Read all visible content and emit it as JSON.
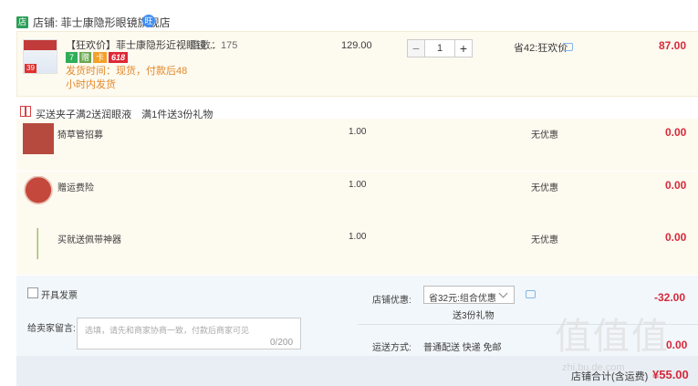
{
  "shop": {
    "icon_text": "店",
    "label": "店铺: 菲士康隐形眼镜旗舰店",
    "badge_text": "旺"
  },
  "item": {
    "thumb_tag": "39",
    "title": "【狂欢价】菲士康隐形近视眼镜…",
    "spec": "度数：175",
    "badges": {
      "seven": "7",
      "gift": "赠",
      "card": "卡",
      "promo": "618"
    },
    "shipping": "发货时间：现货，付款后48小时内发货",
    "price": "129.00",
    "qty": "1",
    "minus": "−",
    "plus": "+",
    "discount": "省42:狂欢价",
    "subtotal": "87.00"
  },
  "gifts": {
    "title": "买送夹子满2送润眼液　满1件送3份礼物",
    "rows": [
      {
        "name": "猗草管招募",
        "price": "1.00",
        "discount": "无优惠",
        "subtotal": "0.00"
      },
      {
        "name": "赠运费险",
        "price": "1.00",
        "discount": "无优惠",
        "subtotal": "0.00"
      },
      {
        "name": "买就送佩带神器",
        "price": "1.00",
        "discount": "无优惠",
        "subtotal": "0.00"
      }
    ]
  },
  "footer": {
    "invoice_label": "开具发票",
    "message_label": "给卖家留言:",
    "message_placeholder": "选填，请先和商家协商一致，付款后商家可见",
    "message_count": "0/200",
    "shop_discount_label": "店铺优惠:",
    "shop_discount_select": "省32元:组合优惠",
    "gift_sent": "送3份礼物",
    "shop_discount_amount": "-32.00",
    "shipping_label": "运送方式:",
    "shipping_value": "普通配送 快递 免邮",
    "shipping_amount": "0.00",
    "total_label": "店铺合计(含运费)",
    "total_amount": "¥55.00"
  },
  "watermark": {
    "text": "值值值",
    "sub": "zhi.bu.de.com"
  },
  "colors": {
    "accent_red": "#d6293a",
    "shop_green": "#2e9e58",
    "warning_orange": "#e28a2b"
  }
}
